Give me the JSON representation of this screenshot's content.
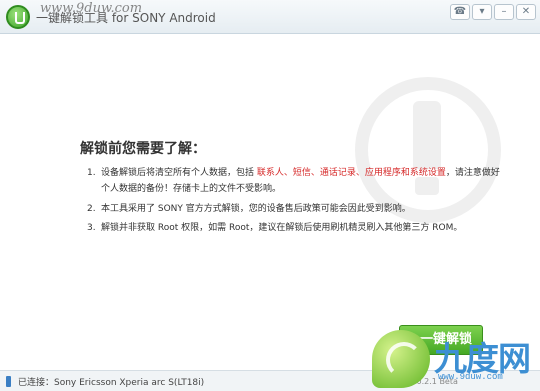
{
  "window": {
    "title": "一键解锁工具 for SONY Android",
    "buttons": {
      "feedback": "☎",
      "menu": "▾",
      "minimize": "–",
      "close": "✕"
    }
  },
  "watermark": {
    "top_url": "www.9duw.com"
  },
  "content": {
    "heading": "解锁前您需要了解：",
    "items": [
      {
        "num": "1.",
        "text_a": "设备解锁后将清空所有个人数据，包括 ",
        "highlight": "联系人、短信、通话记录、应用程序和系统设置",
        "text_b": "，请注意做好个人数据的备份！存储卡上的文件不受影响。"
      },
      {
        "num": "2.",
        "text": "本工具采用了 SONY 官方方式解锁，您的设备售后政策可能会因此受到影响。"
      },
      {
        "num": "3.",
        "text": "解锁并非获取 Root 权限，如需 Root，建议在解锁后使用刷机精灵刷入其他第三方 ROM。"
      }
    ]
  },
  "actions": {
    "unlock_label": "一键解锁"
  },
  "status": {
    "connected": "已连接：Sony Ericsson Xperia arc S(LT18i)",
    "version": "版本 0.2.1 Beta"
  },
  "brand": {
    "name": "九度网",
    "url": "www.9duw.com"
  },
  "colors": {
    "accent_green": "#45a824",
    "warning_red": "#d62828",
    "brand_blue": "#3d8fd3"
  }
}
